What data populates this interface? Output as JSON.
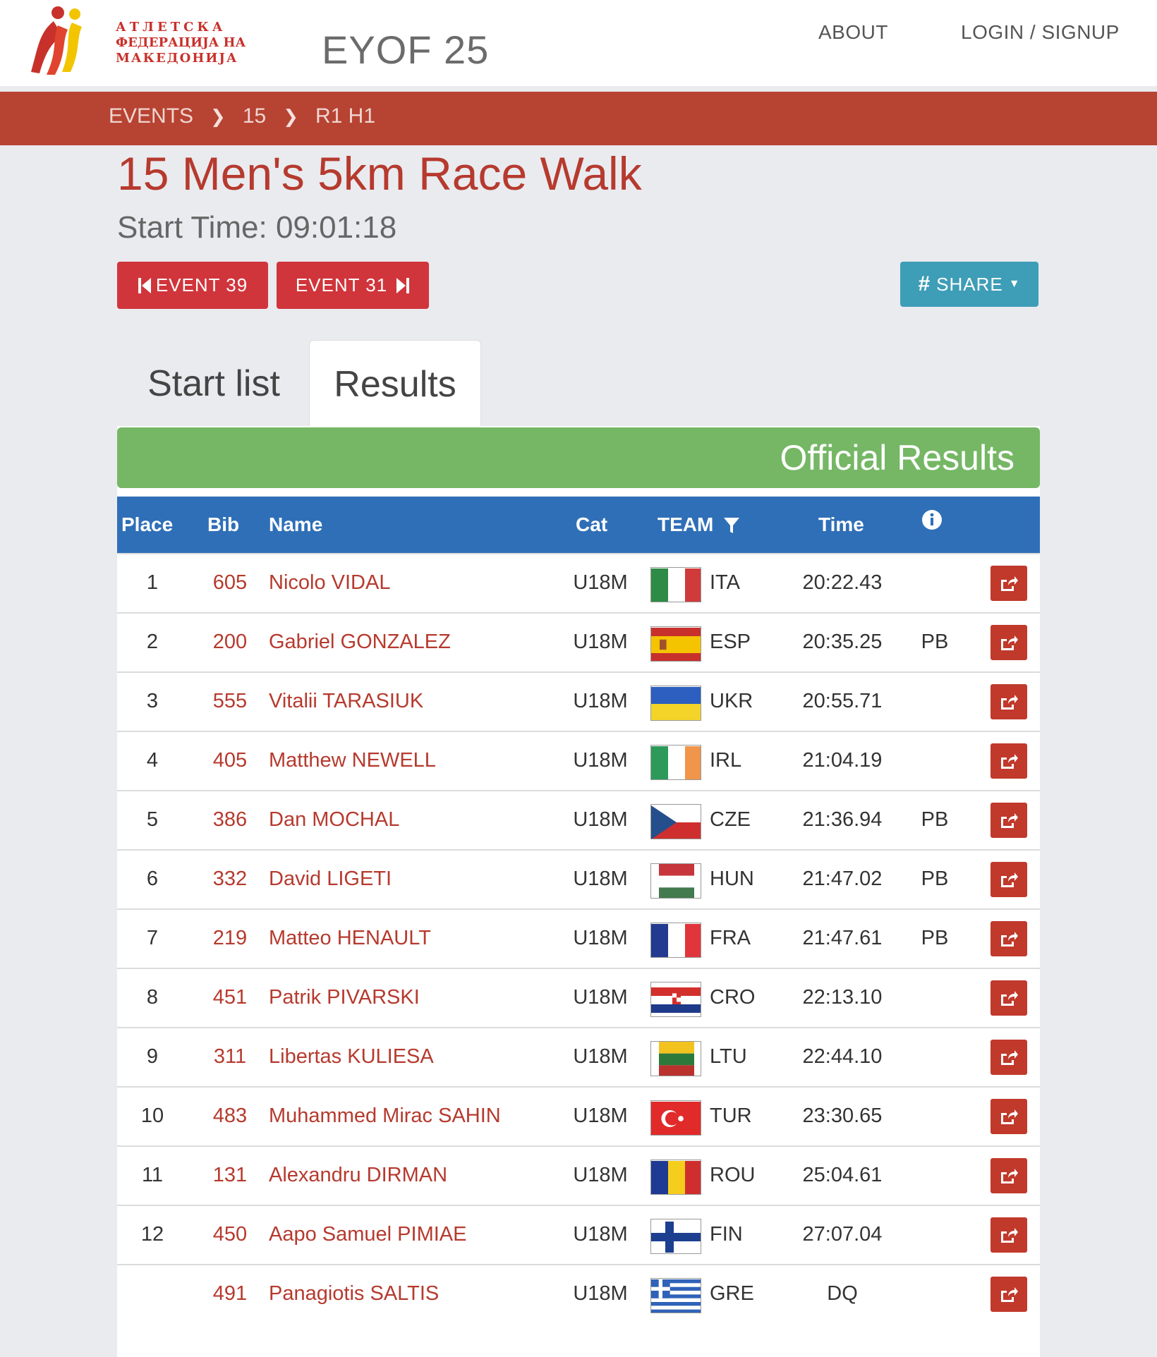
{
  "header": {
    "logo_lines": [
      "АТЛЕТСКА",
      "ФЕДЕРАЦИЈА НА",
      "МАКЕДОНИЈА"
    ],
    "site_title": "EYOF 25",
    "nav": {
      "about": "ABOUT",
      "login": "LOGIN / SIGNUP"
    }
  },
  "breadcrumb": [
    "EVENTS",
    "15",
    "R1 H1"
  ],
  "event": {
    "title": "15 Men's 5km Race Walk",
    "start_time": "Start Time: 09:01:18",
    "prev_button": "EVENT 39",
    "next_button": "EVENT 31",
    "share_button": "SHARE"
  },
  "tabs": [
    "Start list",
    "Results"
  ],
  "banner": "Official Results",
  "table": {
    "headers": {
      "place": "Place",
      "bib": "Bib",
      "name": "Name",
      "cat": "Cat",
      "team": "TEAM",
      "time": "Time"
    },
    "rows": [
      {
        "place": "1",
        "bib": "605",
        "name": "Nicolo VIDAL",
        "cat": "U18M",
        "team": "ITA",
        "time": "20:22.43",
        "note": ""
      },
      {
        "place": "2",
        "bib": "200",
        "name": "Gabriel GONZALEZ",
        "cat": "U18M",
        "team": "ESP",
        "time": "20:35.25",
        "note": "PB"
      },
      {
        "place": "3",
        "bib": "555",
        "name": "Vitalii TARASIUK",
        "cat": "U18M",
        "team": "UKR",
        "time": "20:55.71",
        "note": ""
      },
      {
        "place": "4",
        "bib": "405",
        "name": "Matthew NEWELL",
        "cat": "U18M",
        "team": "IRL",
        "time": "21:04.19",
        "note": ""
      },
      {
        "place": "5",
        "bib": "386",
        "name": "Dan MOCHAL",
        "cat": "U18M",
        "team": "CZE",
        "time": "21:36.94",
        "note": "PB"
      },
      {
        "place": "6",
        "bib": "332",
        "name": "David LIGETI",
        "cat": "U18M",
        "team": "HUN",
        "time": "21:47.02",
        "note": "PB"
      },
      {
        "place": "7",
        "bib": "219",
        "name": "Matteo HENAULT",
        "cat": "U18M",
        "team": "FRA",
        "time": "21:47.61",
        "note": "PB"
      },
      {
        "place": "8",
        "bib": "451",
        "name": "Patrik PIVARSKI",
        "cat": "U18M",
        "team": "CRO",
        "time": "22:13.10",
        "note": ""
      },
      {
        "place": "9",
        "bib": "311",
        "name": "Libertas KULIESA",
        "cat": "U18M",
        "team": "LTU",
        "time": "22:44.10",
        "note": ""
      },
      {
        "place": "10",
        "bib": "483",
        "name": "Muhammed Mirac SAHIN",
        "cat": "U18M",
        "team": "TUR",
        "time": "23:30.65",
        "note": ""
      },
      {
        "place": "11",
        "bib": "131",
        "name": "Alexandru DIRMAN",
        "cat": "U18M",
        "team": "ROU",
        "time": "25:04.61",
        "note": ""
      },
      {
        "place": "12",
        "bib": "450",
        "name": "Aapo Samuel PIMIAE",
        "cat": "U18M",
        "team": "FIN",
        "time": "27:07.04",
        "note": ""
      },
      {
        "place": "",
        "bib": "491",
        "name": "Panagiotis SALTIS",
        "cat": "U18M",
        "team": "GRE",
        "time": "DQ",
        "note": ""
      }
    ]
  },
  "colors": {
    "brand_red": "#b74333",
    "title_red": "#b63a2e",
    "header_blue": "#2f6fb7",
    "banner_green": "#75b765",
    "share_teal": "#3e9db7"
  }
}
